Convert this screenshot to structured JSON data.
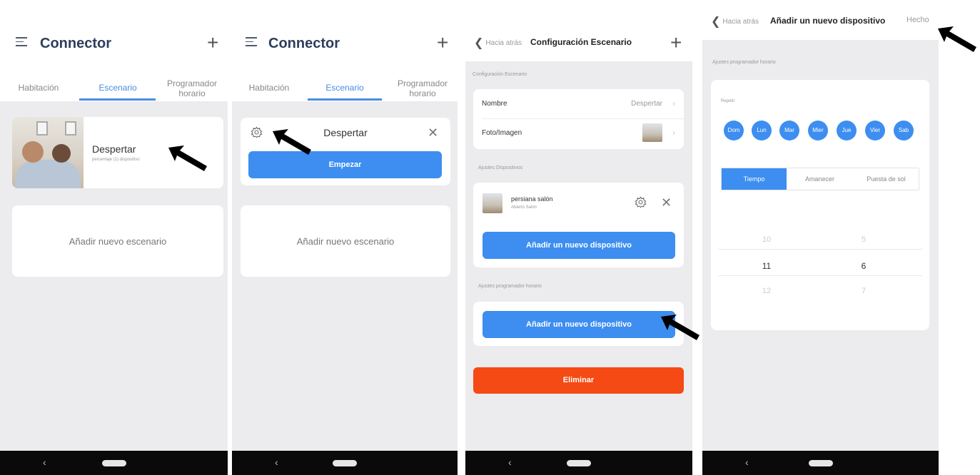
{
  "screen1": {
    "app_title": "Connector",
    "tabs": [
      "Habitación",
      "Escenario",
      "Programador\nhorario"
    ],
    "scene": {
      "name": "Despertar",
      "subtitle": "percentaje (1) dispositivo"
    },
    "add_scene": "Añadir nuevo escenario",
    "nav_back": "‹"
  },
  "screen2": {
    "app_title": "Connector",
    "tabs": [
      "Habitación",
      "Escenario",
      "Programador\nhorario"
    ],
    "scene_name": "Despertar",
    "start_button": "Empezar",
    "add_scene": "Añadir nuevo escenario",
    "nav_back": "‹"
  },
  "screen3": {
    "back_label": "Hacia atrás",
    "title": "Configuración Escenario",
    "section_config": "Configuración Escenario",
    "rows": [
      {
        "label": "Nombre",
        "value": "Despertar"
      },
      {
        "label": "Foto/Imagen",
        "value": ""
      }
    ],
    "section_devices": "Ajustes Dispositivos",
    "device": {
      "name": "persiana salón",
      "room": "Abierto Salón"
    },
    "add_device_button": "Añadir un nuevo dispositivo",
    "section_schedule": "Ajustes programador horario",
    "add_device_button2": "Añadir un nuevo dispositivo",
    "delete_button": "Eliminar",
    "nav_back": "‹"
  },
  "screen4": {
    "back_label": "Hacia atrás",
    "title": "Añadir un nuevo dispositivo",
    "done": "Hecho",
    "section_label": "Ajustes programador horario",
    "repeat_label": "Repetir",
    "days": [
      "Dom",
      "Lun",
      "Mar",
      "Mier",
      "Jue",
      "Vier",
      "Sab"
    ],
    "segments": [
      "Tiempo",
      "Amanecer",
      "Puesta de sol"
    ],
    "picker_hours": [
      "10",
      "11",
      "12"
    ],
    "picker_minutes": [
      "5",
      "6",
      "7"
    ],
    "nav_back": "‹"
  },
  "colors": {
    "accent": "#3d8ef0",
    "danger": "#f54a14",
    "title": "#2d3e5c"
  }
}
